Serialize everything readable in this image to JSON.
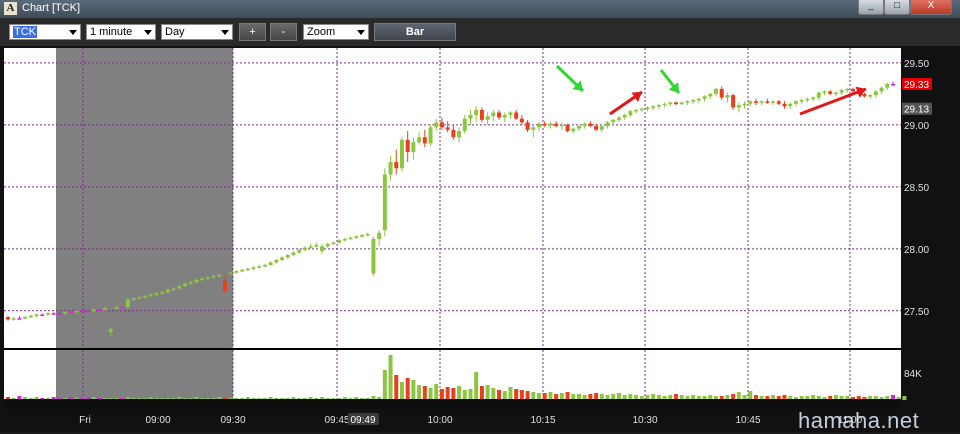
{
  "window": {
    "title": "Chart [TCK]",
    "app_icon_letter": "A",
    "buttons": {
      "minimize": "_",
      "maximize": "□",
      "close": "X"
    }
  },
  "toolbar": {
    "symbol": "TCK",
    "interval": "1 minute",
    "period": "Day",
    "zoom_in": "+",
    "zoom_out": "-",
    "zoom": "Zoom",
    "bar": "Bar"
  },
  "watermark": "hamaha.net",
  "colors": {
    "up": "#8cc63f",
    "down": "#e8401c",
    "magenta": "#e020e0",
    "grid": "#7b2c8c",
    "premarket": "#808080",
    "price_tag": "#e00000",
    "prev_tag": "#555555"
  },
  "chart_data": {
    "type": "candlestick",
    "symbol": "TCK",
    "y_ticks": [
      "29.50",
      "29.00",
      "28.50",
      "28.00",
      "27.50"
    ],
    "y_range": [
      27.2,
      29.62
    ],
    "x_labels": [
      "Fri",
      "09:00",
      "09:30",
      "09:45",
      "10:00",
      "10:15",
      "10:30",
      "10:45",
      "11:00"
    ],
    "crosshair_time": "09:49",
    "last_price": "29.33",
    "reference_price": "29.13",
    "volume_label": "84K",
    "premarket_shaded": [
      "Fri",
      "09:30"
    ],
    "candles": [
      [
        27.45,
        27.46,
        27.42,
        27.43
      ],
      [
        27.43,
        27.45,
        27.42,
        27.44
      ],
      [
        27.44,
        27.46,
        27.43,
        27.44
      ],
      [
        27.44,
        27.46,
        27.43,
        27.45
      ],
      [
        27.45,
        27.47,
        27.44,
        27.46
      ],
      [
        27.46,
        27.48,
        27.45,
        27.47
      ],
      [
        27.47,
        27.48,
        27.46,
        27.47
      ],
      [
        27.47,
        27.49,
        27.46,
        27.48
      ],
      [
        27.48,
        27.49,
        27.47,
        27.48
      ],
      [
        27.48,
        27.49,
        27.47,
        27.48
      ],
      [
        27.48,
        27.5,
        27.47,
        27.49
      ],
      [
        27.49,
        27.5,
        27.48,
        27.49
      ],
      [
        27.49,
        27.5,
        27.48,
        27.5
      ],
      [
        27.5,
        27.51,
        27.49,
        27.5
      ],
      [
        27.5,
        27.51,
        27.49,
        27.5
      ],
      [
        27.5,
        27.52,
        27.49,
        27.51
      ],
      [
        27.51,
        27.52,
        27.5,
        27.51
      ],
      [
        27.51,
        27.53,
        27.5,
        27.52
      ],
      [
        27.33,
        27.36,
        27.3,
        27.35
      ],
      [
        27.52,
        27.54,
        27.51,
        27.53
      ],
      [
        27.53,
        27.54,
        27.52,
        27.53
      ],
      [
        27.53,
        27.6,
        27.52,
        27.59
      ],
      [
        27.59,
        27.61,
        27.58,
        27.6
      ],
      [
        27.6,
        27.62,
        27.59,
        27.61
      ],
      [
        27.61,
        27.63,
        27.6,
        27.62
      ],
      [
        27.62,
        27.64,
        27.61,
        27.63
      ],
      [
        27.63,
        27.65,
        27.62,
        27.64
      ],
      [
        27.64,
        27.66,
        27.63,
        27.65
      ],
      [
        27.65,
        27.68,
        27.64,
        27.67
      ],
      [
        27.67,
        27.69,
        27.66,
        27.68
      ],
      [
        27.68,
        27.71,
        27.67,
        27.7
      ],
      [
        27.7,
        27.73,
        27.69,
        27.72
      ],
      [
        27.72,
        27.74,
        27.71,
        27.73
      ],
      [
        27.73,
        27.76,
        27.72,
        27.75
      ],
      [
        27.75,
        27.77,
        27.74,
        27.76
      ],
      [
        27.76,
        27.78,
        27.75,
        27.77
      ],
      [
        27.77,
        27.79,
        27.76,
        27.78
      ],
      [
        27.78,
        27.8,
        27.77,
        27.79
      ],
      [
        27.74,
        27.78,
        27.64,
        27.66
      ],
      [
        27.8,
        27.82,
        27.79,
        27.81
      ],
      [
        27.81,
        27.83,
        27.8,
        27.82
      ],
      [
        27.82,
        27.84,
        27.81,
        27.83
      ],
      [
        27.83,
        27.85,
        27.82,
        27.84
      ],
      [
        27.84,
        27.86,
        27.83,
        27.85
      ],
      [
        27.85,
        27.87,
        27.84,
        27.86
      ],
      [
        27.86,
        27.88,
        27.85,
        27.87
      ],
      [
        27.87,
        27.9,
        27.86,
        27.89
      ],
      [
        27.89,
        27.92,
        27.88,
        27.91
      ],
      [
        27.91,
        27.94,
        27.9,
        27.93
      ],
      [
        27.93,
        27.96,
        27.92,
        27.95
      ],
      [
        27.95,
        27.98,
        27.94,
        27.97
      ],
      [
        27.97,
        28.0,
        27.96,
        27.99
      ],
      [
        27.99,
        28.02,
        27.98,
        28.01
      ],
      [
        28.01,
        28.04,
        28.0,
        28.02
      ],
      [
        28.02,
        28.05,
        28.01,
        28.03
      ],
      [
        27.98,
        28.04,
        27.96,
        28.02
      ],
      [
        28.02,
        28.05,
        28.01,
        28.04
      ],
      [
        28.04,
        28.06,
        28.03,
        28.05
      ],
      [
        28.05,
        28.08,
        28.04,
        28.07
      ],
      [
        28.07,
        28.09,
        28.06,
        28.08
      ],
      [
        28.08,
        28.1,
        28.07,
        28.09
      ],
      [
        28.09,
        28.11,
        28.08,
        28.1
      ],
      [
        28.1,
        28.12,
        28.09,
        28.11
      ],
      [
        28.11,
        28.13,
        28.1,
        28.12
      ],
      [
        27.8,
        28.1,
        27.78,
        28.08
      ],
      [
        28.08,
        28.15,
        28.02,
        28.13
      ],
      [
        28.15,
        28.65,
        28.1,
        28.6
      ],
      [
        28.6,
        28.75,
        28.55,
        28.7
      ],
      [
        28.7,
        28.8,
        28.6,
        28.65
      ],
      [
        28.65,
        28.9,
        28.62,
        28.88
      ],
      [
        28.88,
        28.95,
        28.7,
        28.78
      ],
      [
        28.78,
        28.9,
        28.72,
        28.86
      ],
      [
        28.86,
        28.94,
        28.84,
        28.9
      ],
      [
        28.9,
        28.96,
        28.82,
        28.85
      ],
      [
        28.85,
        29.0,
        28.83,
        28.98
      ],
      [
        28.98,
        29.05,
        28.95,
        29.02
      ],
      [
        29.02,
        29.06,
        28.96,
        28.98
      ],
      [
        28.98,
        29.03,
        28.94,
        28.96
      ],
      [
        28.96,
        29.0,
        28.88,
        28.9
      ],
      [
        28.9,
        28.98,
        28.86,
        28.95
      ],
      [
        28.95,
        29.08,
        28.93,
        29.05
      ],
      [
        29.05,
        29.12,
        29.0,
        29.08
      ],
      [
        29.08,
        29.15,
        29.02,
        29.12
      ],
      [
        29.12,
        29.14,
        29.02,
        29.04
      ],
      [
        29.04,
        29.1,
        29.0,
        29.07
      ],
      [
        29.07,
        29.12,
        29.03,
        29.1
      ],
      [
        29.1,
        29.12,
        29.04,
        29.06
      ],
      [
        29.06,
        29.1,
        29.02,
        29.08
      ],
      [
        29.08,
        29.11,
        29.05,
        29.1
      ],
      [
        29.1,
        29.12,
        29.04,
        29.05
      ],
      [
        29.05,
        29.08,
        29.0,
        29.02
      ],
      [
        29.02,
        29.04,
        28.94,
        28.96
      ],
      [
        28.96,
        29.0,
        28.9,
        28.98
      ],
      [
        28.98,
        29.02,
        28.95,
        29.01
      ],
      [
        29.01,
        29.03,
        28.98,
        29.0
      ],
      [
        29.0,
        29.02,
        28.97,
        29.01
      ],
      [
        29.01,
        29.03,
        28.98,
        28.99
      ],
      [
        28.99,
        29.02,
        28.96,
        29.0
      ],
      [
        29.0,
        29.01,
        28.94,
        28.95
      ],
      [
        28.95,
        28.98,
        28.93,
        28.97
      ],
      [
        28.97,
        29.0,
        28.95,
        28.99
      ],
      [
        28.99,
        29.02,
        28.97,
        29.01
      ],
      [
        29.01,
        29.03,
        28.98,
        28.99
      ],
      [
        28.99,
        29.01,
        28.95,
        28.96
      ],
      [
        28.96,
        29.0,
        28.94,
        28.99
      ],
      [
        28.99,
        29.03,
        28.97,
        29.02
      ],
      [
        29.02,
        29.05,
        29.0,
        29.04
      ],
      [
        29.04,
        29.07,
        29.02,
        29.06
      ],
      [
        29.06,
        29.09,
        29.04,
        29.08
      ],
      [
        29.08,
        29.12,
        29.06,
        29.11
      ],
      [
        29.11,
        29.13,
        29.09,
        29.12
      ],
      [
        29.12,
        29.14,
        29.1,
        29.13
      ],
      [
        29.13,
        29.15,
        29.11,
        29.14
      ],
      [
        29.14,
        29.16,
        29.12,
        29.15
      ],
      [
        29.15,
        29.17,
        29.13,
        29.16
      ],
      [
        29.16,
        29.18,
        29.14,
        29.17
      ],
      [
        29.17,
        29.19,
        29.15,
        29.18
      ],
      [
        29.18,
        29.19,
        29.16,
        29.17
      ],
      [
        29.17,
        29.19,
        29.16,
        29.18
      ],
      [
        29.18,
        29.2,
        29.16,
        29.19
      ],
      [
        29.19,
        29.21,
        29.17,
        29.2
      ],
      [
        29.2,
        29.22,
        29.18,
        29.21
      ],
      [
        29.21,
        29.24,
        29.19,
        29.23
      ],
      [
        29.23,
        29.26,
        29.21,
        29.25
      ],
      [
        29.25,
        29.3,
        29.23,
        29.29
      ],
      [
        29.29,
        29.31,
        29.2,
        29.22
      ],
      [
        29.22,
        29.26,
        29.18,
        29.24
      ],
      [
        29.24,
        29.25,
        29.12,
        29.14
      ],
      [
        29.14,
        29.18,
        29.1,
        29.16
      ],
      [
        29.16,
        29.19,
        29.13,
        29.17
      ],
      [
        29.17,
        29.2,
        29.15,
        29.19
      ],
      [
        29.19,
        29.21,
        29.16,
        29.18
      ],
      [
        29.18,
        29.2,
        29.16,
        29.19
      ],
      [
        29.19,
        29.21,
        29.17,
        29.18
      ],
      [
        29.18,
        29.2,
        29.16,
        29.19
      ],
      [
        29.19,
        29.2,
        29.16,
        29.17
      ],
      [
        29.17,
        29.19,
        29.13,
        29.15
      ],
      [
        29.15,
        29.18,
        29.13,
        29.17
      ],
      [
        29.17,
        29.2,
        29.15,
        29.19
      ],
      [
        29.19,
        29.21,
        29.17,
        29.2
      ],
      [
        29.2,
        29.22,
        29.18,
        29.21
      ],
      [
        29.21,
        29.23,
        29.19,
        29.22
      ],
      [
        29.22,
        29.27,
        29.2,
        29.26
      ],
      [
        29.26,
        29.28,
        29.24,
        29.27
      ],
      [
        29.27,
        29.28,
        29.24,
        29.25
      ],
      [
        29.25,
        29.27,
        29.23,
        29.26
      ],
      [
        29.26,
        29.29,
        29.24,
        29.28
      ],
      [
        29.28,
        29.3,
        29.26,
        29.29
      ],
      [
        29.29,
        29.3,
        29.26,
        29.27
      ],
      [
        29.27,
        29.28,
        29.24,
        29.25
      ],
      [
        29.25,
        29.26,
        29.22,
        29.23
      ],
      [
        29.23,
        29.25,
        29.21,
        29.24
      ],
      [
        29.24,
        29.28,
        29.22,
        29.27
      ],
      [
        29.27,
        29.31,
        29.25,
        29.3
      ],
      [
        29.3,
        29.34,
        29.28,
        29.33
      ],
      [
        29.33,
        29.35,
        29.31,
        29.33
      ]
    ],
    "volume": [
      3,
      2,
      4,
      3,
      2,
      3,
      2,
      2,
      3,
      2,
      2,
      3,
      2,
      2,
      2,
      3,
      2,
      2,
      2,
      2,
      2,
      3,
      2,
      2,
      2,
      3,
      2,
      2,
      2,
      2,
      3,
      2,
      2,
      3,
      2,
      2,
      2,
      3,
      2,
      2,
      2,
      2,
      3,
      2,
      2,
      2,
      3,
      2,
      2,
      2,
      3,
      2,
      2,
      3,
      2,
      3,
      2,
      2,
      2,
      3,
      2,
      3,
      2,
      2,
      4,
      3,
      30,
      45,
      25,
      18,
      22,
      20,
      15,
      14,
      12,
      16,
      11,
      13,
      12,
      14,
      10,
      11,
      28,
      14,
      15,
      12,
      10,
      9,
      13,
      11,
      10,
      9,
      8,
      7,
      7,
      8,
      6,
      7,
      8,
      6,
      6,
      5,
      6,
      7,
      6,
      5,
      6,
      7,
      5,
      6,
      5,
      4,
      5,
      6,
      5,
      4,
      5,
      6,
      5,
      4,
      5,
      4,
      4,
      5,
      4,
      4,
      5,
      6,
      8,
      5,
      9,
      5,
      4,
      4,
      5,
      4,
      5,
      4,
      3,
      4,
      4,
      5,
      4,
      3,
      4,
      5,
      4,
      4,
      3,
      4,
      3,
      4,
      4,
      3,
      4,
      5,
      3,
      4
    ],
    "arrows": [
      {
        "color": "green",
        "time": "10:21"
      },
      {
        "color": "red",
        "time": "10:30"
      },
      {
        "color": "green",
        "time": "10:32"
      },
      {
        "color": "red",
        "time": "10:57"
      }
    ]
  }
}
